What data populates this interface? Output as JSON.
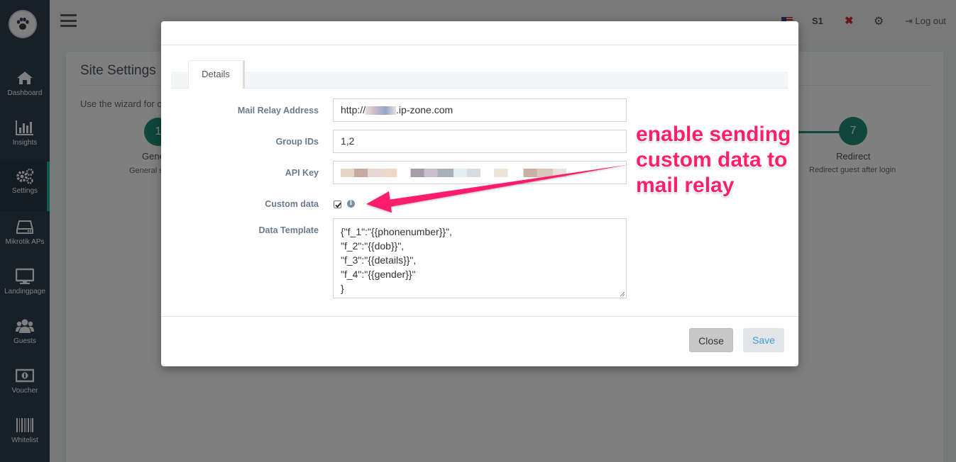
{
  "sidebar": {
    "items": [
      {
        "label": "Dashboard",
        "icon": "home-icon"
      },
      {
        "label": "Insights",
        "icon": "bar-chart-icon"
      },
      {
        "label": "Settings",
        "icon": "gears-icon"
      },
      {
        "label": "Mikrotik APs",
        "icon": "router-icon"
      },
      {
        "label": "Landingpage",
        "icon": "monitor-icon"
      },
      {
        "label": "Guests",
        "icon": "users-icon"
      },
      {
        "label": "Voucher",
        "icon": "money-icon"
      },
      {
        "label": "Whitelist",
        "icon": "barcode-icon"
      }
    ]
  },
  "topbar": {
    "site": "S1",
    "logout": "Log out"
  },
  "page": {
    "title": "Site Settings",
    "desc": "Use the wizard for c",
    "steps": [
      {
        "num": "1",
        "title": "Gene",
        "sub": "General s"
      },
      {
        "num": "7",
        "title": "Redirect",
        "sub": "Redirect guest after login"
      }
    ]
  },
  "modal": {
    "tab": "Details",
    "fields": {
      "mail_relay_label": "Mail Relay Address",
      "mail_relay_value_prefix": "http://",
      "mail_relay_value_suffix": ".ip-zone.com",
      "group_ids_label": "Group IDs",
      "group_ids_value": "1,2",
      "api_key_label": "API Key",
      "custom_data_label": "Custom data",
      "custom_data_checked": true,
      "data_template_label": "Data Template",
      "data_template_value": "{\"f_1\":\"{{phonenumber}}\",\n\"f_2\":\"{{dob}}\",\n\"f_3\":\"{{details}}\",\n\"f_4\":\"{{gender}}\"\n}"
    },
    "buttons": {
      "close": "Close",
      "save": "Save"
    }
  },
  "annotation": {
    "line1": "enable sending",
    "line2": "custom data to",
    "line3": "mail relay",
    "color": "#ff1f6d"
  }
}
